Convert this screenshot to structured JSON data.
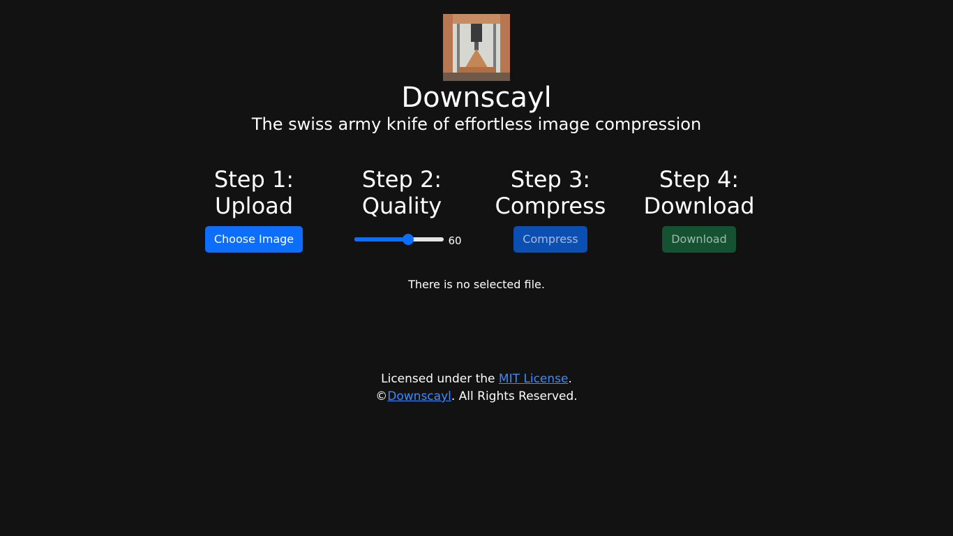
{
  "header": {
    "title": "Downscayl",
    "subtitle": "The swiss army knife of effortless image compression",
    "logo": "downscayl-logo"
  },
  "steps": [
    {
      "title_line1": "Step 1:",
      "title_line2": "Upload",
      "button_label": "Choose Image"
    },
    {
      "title_line1": "Step 2:",
      "title_line2": "Quality",
      "quality_value": "60",
      "quality_fraction": 0.6
    },
    {
      "title_line1": "Step 3:",
      "title_line2": "Compress",
      "button_label": "Compress"
    },
    {
      "title_line1": "Step 4:",
      "title_line2": "Download",
      "button_label": "Download"
    }
  ],
  "status": {
    "text": "There is no selected file."
  },
  "footer": {
    "license_prefix": "Licensed under the ",
    "license_link": "MIT License",
    "license_suffix": ".",
    "copyright_symbol": "©",
    "copyright_link": "Downscayl",
    "copyright_suffix": ". All Rights Reserved."
  },
  "colors": {
    "background": "#121212",
    "primary": "#0d6efd",
    "compress_disabled": "#0b4fb3",
    "download_disabled": "#145232",
    "link": "#3d8bfd"
  }
}
